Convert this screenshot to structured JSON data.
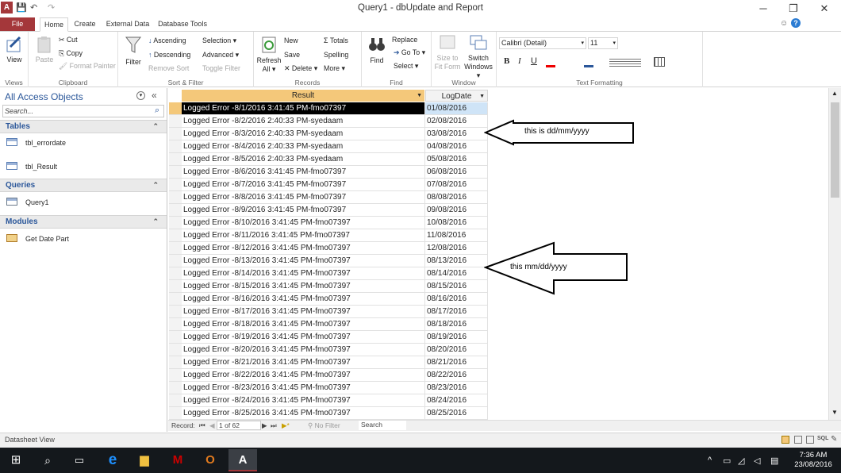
{
  "window": {
    "title": "Query1 - dbUpdate and Report",
    "qat_save": "💾",
    "qat_undo": "↶",
    "qat_redo": "↷",
    "help_glyph": "?",
    "min_glyph": "─",
    "restore_glyph": "❐",
    "close_glyph": "✕"
  },
  "tabs": {
    "file": "File",
    "home": "Home",
    "create": "Create",
    "external": "External Data",
    "dbtools": "Database Tools"
  },
  "ribbon": {
    "views": {
      "view": "View",
      "label": "Views"
    },
    "clipboard": {
      "paste": "Paste",
      "cut": "Cut",
      "copy": "Copy",
      "painter": "Format Painter",
      "label": "Clipboard"
    },
    "sortfilter": {
      "filter": "Filter",
      "ascending": "Ascending",
      "descending": "Descending",
      "remove_sort": "Remove Sort",
      "selection": "Selection ▾",
      "advanced": "Advanced ▾",
      "toggle": "Toggle Filter",
      "label": "Sort & Filter"
    },
    "records": {
      "refresh": "Refresh",
      "refresh2": "All ▾",
      "new": "New",
      "save": "Save",
      "delete": "Delete ▾",
      "totals": "Totals",
      "spelling": "Spelling",
      "more": "More ▾",
      "label": "Records"
    },
    "find": {
      "find": "Find",
      "replace": "Replace",
      "goto": "Go To ▾",
      "select": "Select ▾",
      "label": "Find"
    },
    "window": {
      "size": "Size to",
      "size2": "Fit Form",
      "switch": "Switch",
      "switch2": "Windows ▾",
      "label": "Window"
    },
    "text": {
      "font": "Calibri (Detail)",
      "size": "11",
      "bold": "B",
      "italic": "I",
      "underline": "U",
      "label": "Text Formatting"
    }
  },
  "nav": {
    "title": "All Access Objects",
    "search_placeholder": "Search...",
    "tables_label": "Tables",
    "tables": [
      "tbl_errordate",
      "tbl_Result"
    ],
    "queries_label": "Queries",
    "queries": [
      "Query1"
    ],
    "modules_label": "Modules",
    "modules": [
      "Get Date Part"
    ],
    "collapse_glyph": "«",
    "section_chevron": "⌃"
  },
  "grid": {
    "col_result": "Result",
    "col_logdate": "LogDate",
    "rows": [
      [
        "Logged Error -8/1/2016 3:41:45 PM-fmo07397",
        "01/08/2016"
      ],
      [
        "Logged Error -8/2/2016 2:40:33 PM-syedaam",
        "02/08/2016"
      ],
      [
        "Logged Error -8/3/2016 2:40:33 PM-syedaam",
        "03/08/2016"
      ],
      [
        "Logged Error -8/4/2016 2:40:33 PM-syedaam",
        "04/08/2016"
      ],
      [
        "Logged Error -8/5/2016 2:40:33 PM-syedaam",
        "05/08/2016"
      ],
      [
        "Logged Error -8/6/2016 3:41:45 PM-fmo07397",
        "06/08/2016"
      ],
      [
        "Logged Error -8/7/2016 3:41:45 PM-fmo07397",
        "07/08/2016"
      ],
      [
        "Logged Error -8/8/2016 3:41:45 PM-fmo07397",
        "08/08/2016"
      ],
      [
        "Logged Error -8/9/2016 3:41:45 PM-fmo07397",
        "09/08/2016"
      ],
      [
        "Logged Error -8/10/2016 3:41:45 PM-fmo07397",
        "10/08/2016"
      ],
      [
        "Logged Error -8/11/2016 3:41:45 PM-fmo07397",
        "11/08/2016"
      ],
      [
        "Logged Error -8/12/2016 3:41:45 PM-fmo07397",
        "12/08/2016"
      ],
      [
        "Logged Error -8/13/2016 3:41:45 PM-fmo07397",
        "08/13/2016"
      ],
      [
        "Logged Error -8/14/2016 3:41:45 PM-fmo07397",
        "08/14/2016"
      ],
      [
        "Logged Error -8/15/2016 3:41:45 PM-fmo07397",
        "08/15/2016"
      ],
      [
        "Logged Error -8/16/2016 3:41:45 PM-fmo07397",
        "08/16/2016"
      ],
      [
        "Logged Error -8/17/2016 3:41:45 PM-fmo07397",
        "08/17/2016"
      ],
      [
        "Logged Error -8/18/2016 3:41:45 PM-fmo07397",
        "08/18/2016"
      ],
      [
        "Logged Error -8/19/2016 3:41:45 PM-fmo07397",
        "08/19/2016"
      ],
      [
        "Logged Error -8/20/2016 3:41:45 PM-fmo07397",
        "08/20/2016"
      ],
      [
        "Logged Error -8/21/2016 3:41:45 PM-fmo07397",
        "08/21/2016"
      ],
      [
        "Logged Error -8/22/2016 3:41:45 PM-fmo07397",
        "08/22/2016"
      ],
      [
        "Logged Error -8/23/2016 3:41:45 PM-fmo07397",
        "08/23/2016"
      ],
      [
        "Logged Error -8/24/2016 3:41:45 PM-fmo07397",
        "08/24/2016"
      ],
      [
        "Logged Error -8/25/2016 3:41:45 PM-fmo07397",
        "08/25/2016"
      ]
    ]
  },
  "callouts": {
    "top": "this is dd/mm/yyyy",
    "bottom": "this mm/dd/yyyy"
  },
  "recnav": {
    "label": "Record:",
    "position": "1 of 62",
    "nofilter": "No Filter",
    "search": "Search"
  },
  "status": {
    "text": "Datasheet View"
  },
  "taskbar": {
    "time": "7:36 AM",
    "date": "23/08/2016"
  },
  "colors": {
    "file_tab": "#a4373a",
    "header_selected": "#f4c87a",
    "accent": "#2b579a"
  }
}
